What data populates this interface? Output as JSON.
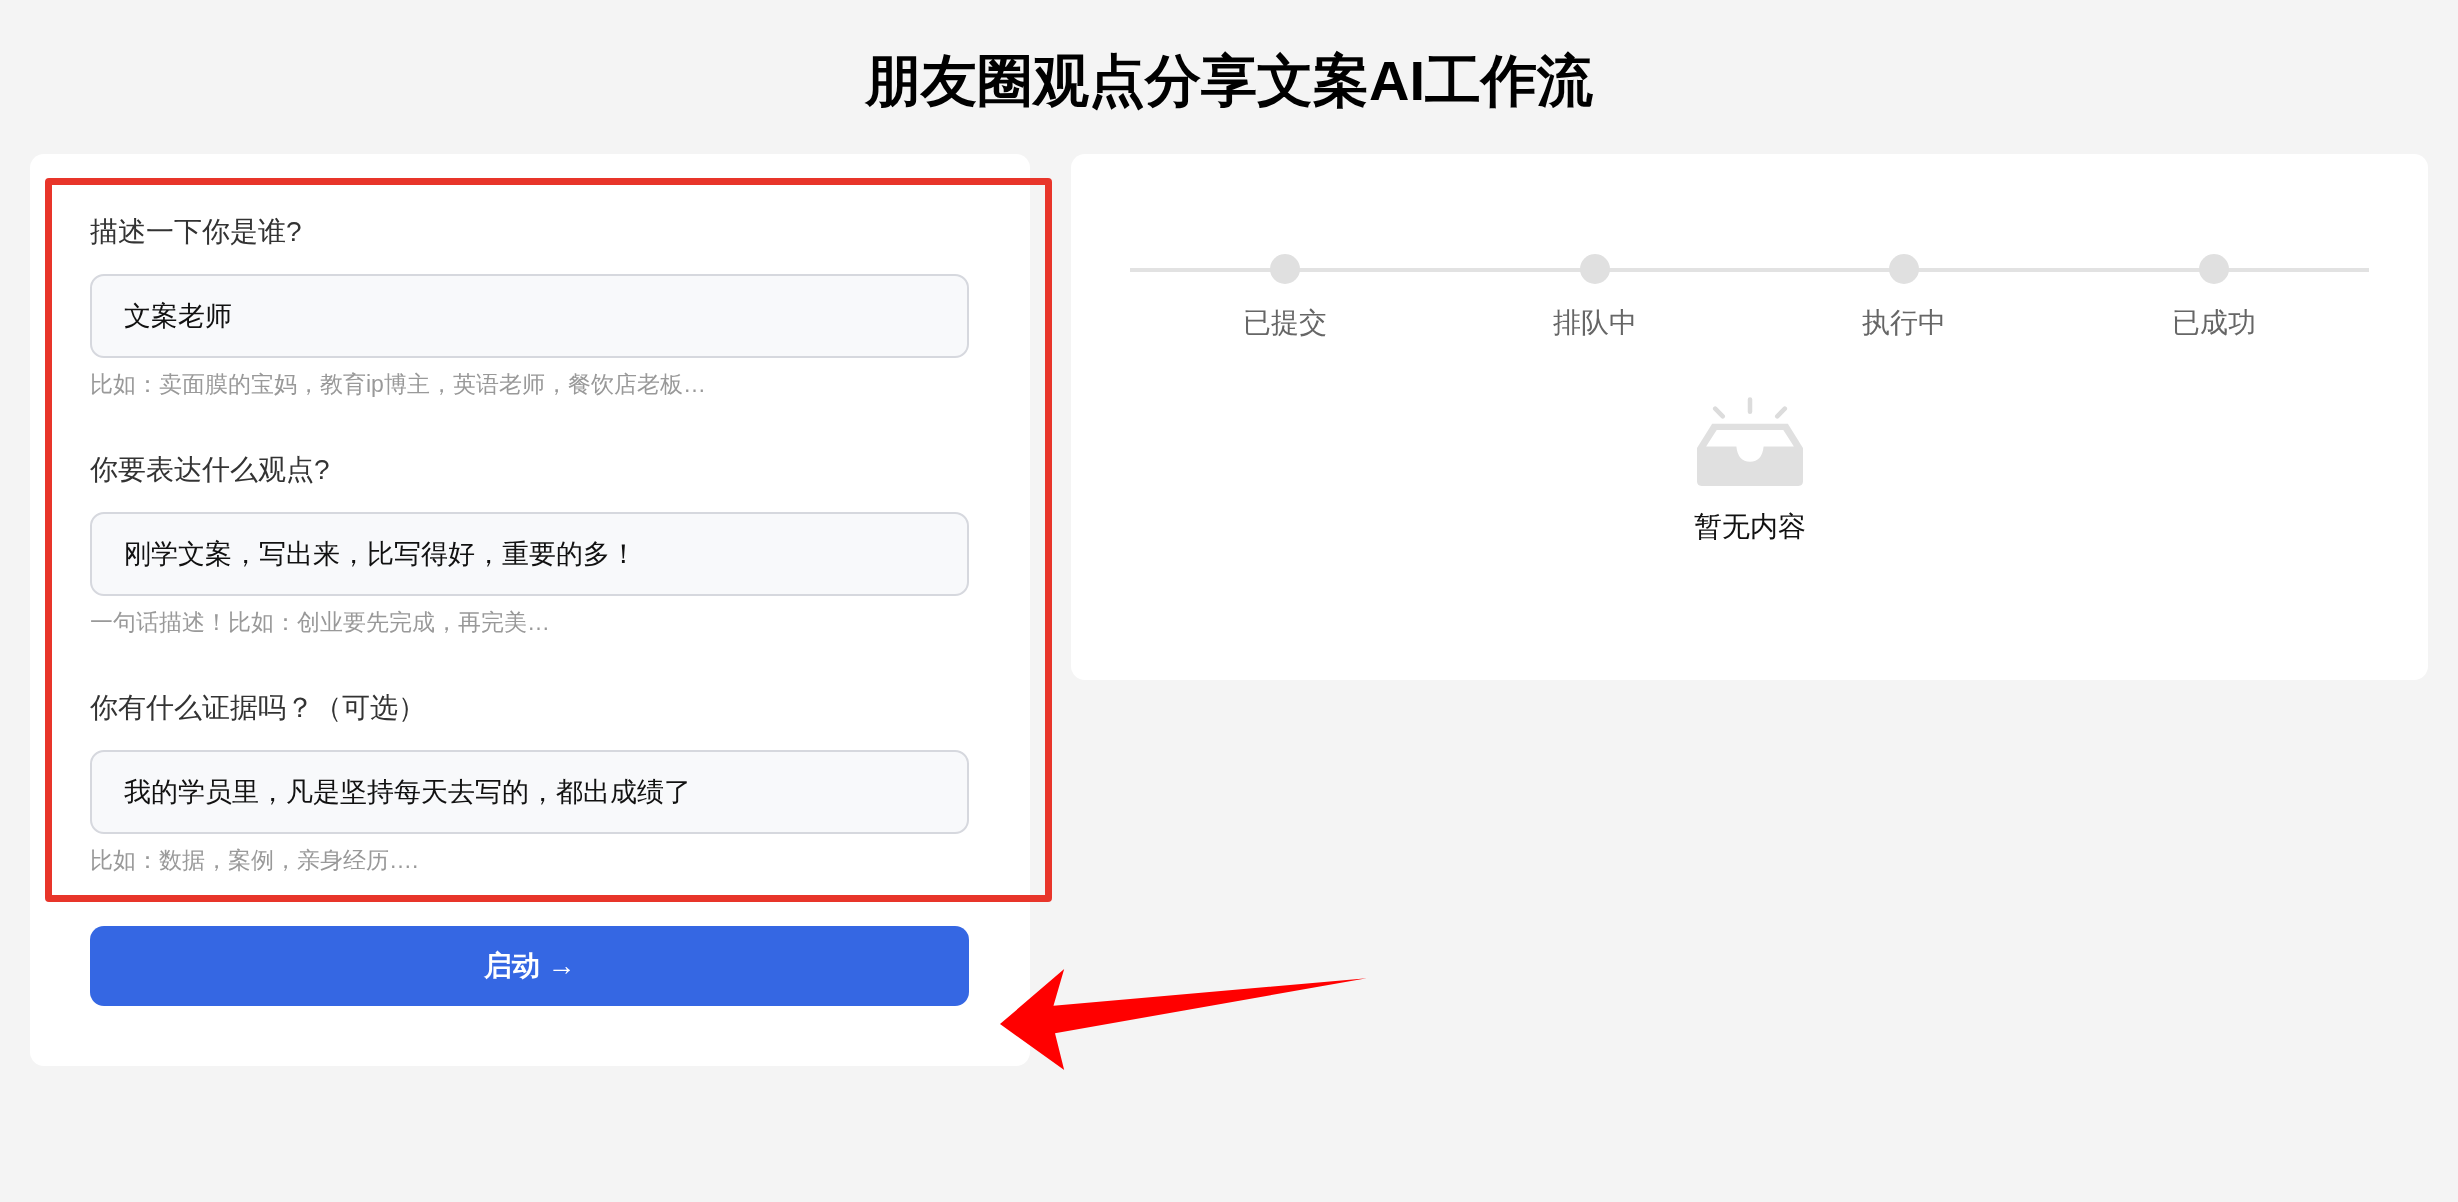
{
  "title": "朋友圈观点分享文案AI工作流",
  "form": {
    "fields": [
      {
        "label": "描述一下你是谁?",
        "value": "文案老师",
        "hint": "比如：卖面膜的宝妈，教育ip博主，英语老师，餐饮店老板…"
      },
      {
        "label": "你要表达什么观点?",
        "value": "刚学文案，写出来，比写得好，重要的多！",
        "hint": "一句话描述！比如：创业要先完成，再完美…"
      },
      {
        "label": "你有什么证据吗？（可选）",
        "value": "我的学员里，凡是坚持每天去写的，都出成绩了",
        "hint": "比如：数据，案例，亲身经历…."
      }
    ],
    "submit": "启动 →"
  },
  "progress": {
    "steps": [
      "已提交",
      "排队中",
      "执行中",
      "已成功"
    ],
    "empty_text": "暂无内容"
  }
}
